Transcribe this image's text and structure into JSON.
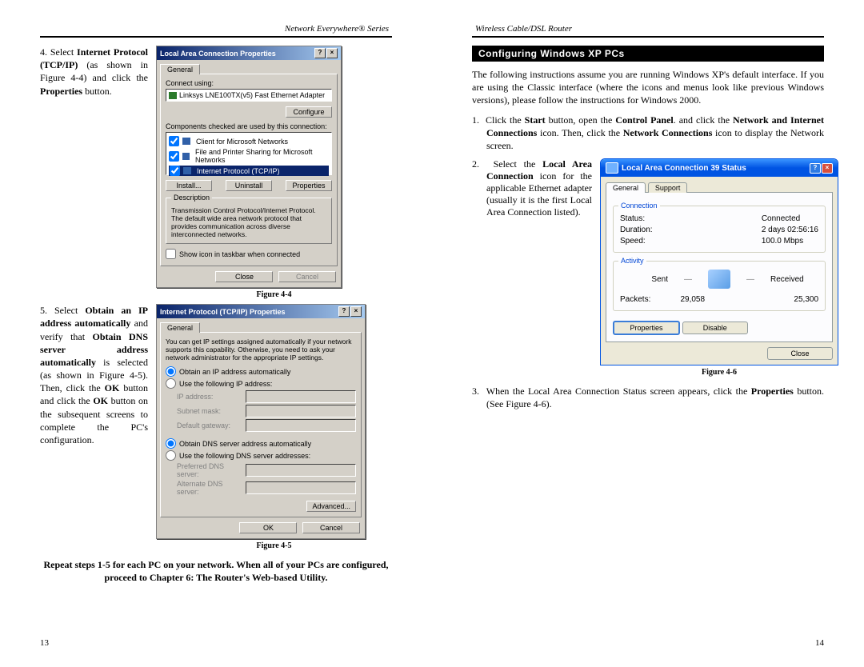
{
  "left": {
    "header": "Network Everywhere® Series",
    "page_no": "13",
    "step4": {
      "num": "4.",
      "text_pre": "Select ",
      "b1": "Internet Protocol (TCP/IP)",
      "text_mid": " (as shown in Figure 4-4) and click the ",
      "b2": "Properties",
      "text_post": " button."
    },
    "step5": {
      "num": "5.",
      "p1a": "Select ",
      "p1b": "Obtain an IP address automatically",
      "p1c": " and verify that ",
      "p1d": "Obtain DNS server address automatically",
      "p1e": " is selected (as shown in Figure 4-5). Then, click the ",
      "p1f": "OK",
      "p1g": " button and click the ",
      "p1h": "OK",
      "p1i": " button on the subsequent screens to complete the PC's configuration."
    },
    "footer_note": "Repeat steps 1-5 for each PC on your network.  When all of your PCs are configured, proceed to Chapter 6: The Router's Web-based Utility.",
    "fig44": {
      "caption": "Figure 4-4",
      "title": "Local Area Connection Properties",
      "tab_general": "General",
      "connect_using_lbl": "Connect using:",
      "adapter": "Linksys LNE100TX(v5) Fast Ethernet Adapter",
      "configure": "Configure",
      "components_lbl": "Components checked are used by this connection:",
      "comp1": "Client for Microsoft Networks",
      "comp2": "File and Printer Sharing for Microsoft Networks",
      "comp3": "Internet Protocol (TCP/IP)",
      "install": "Install...",
      "uninstall": "Uninstall",
      "properties": "Properties",
      "desc_lbl": "Description",
      "desc": "Transmission Control Protocol/Internet Protocol. The default wide area network protocol that provides communication across diverse interconnected networks.",
      "show_icon": "Show icon in taskbar when connected",
      "close": "Close",
      "cancel": "Cancel"
    },
    "fig45": {
      "caption": "Figure 4-5",
      "title": "Internet Protocol (TCP/IP) Properties",
      "tab_general": "General",
      "intro": "You can get IP settings assigned automatically if your network supports this capability. Otherwise, you need to ask your network administrator for the appropriate IP settings.",
      "r1": "Obtain an IP address automatically",
      "r2": "Use the following IP address:",
      "ip_lbl": "IP address:",
      "mask_lbl": "Subnet mask:",
      "gw_lbl": "Default gateway:",
      "r3": "Obtain DNS server address automatically",
      "r4": "Use the following DNS server addresses:",
      "pdns": "Preferred DNS server:",
      "adns": "Alternate DNS server:",
      "advanced": "Advanced...",
      "ok": "OK",
      "cancel": "Cancel"
    }
  },
  "right": {
    "header": "Wireless Cable/DSL Router",
    "page_no": "14",
    "section_title": "Configuring Windows XP PCs",
    "intro": "The following instructions assume you are running Windows XP's default interface. If you are using the Classic interface (where the icons and menus look like previous Windows versions), please follow the instructions for Windows 2000.",
    "step1": {
      "num": "1.",
      "a": "Click the ",
      "b": "Start",
      "c": " button, open the ",
      "d": "Control Panel",
      "e": ". and click the ",
      "f": "Network and Internet Connections",
      "g": " icon. Then, click the ",
      "h": "Network Connections",
      "i": " icon to display the Network screen."
    },
    "step2": {
      "num": "2.",
      "a": "Select the ",
      "b": "Local Area Connection",
      "c": " icon for the applicable Ethernet adapter (usually it is the first Local Area Connection listed)."
    },
    "step3": {
      "num": "3.",
      "a": "When the Local Area Connection Status screen appears, click the ",
      "b": "Properties",
      "c": " button. (See Figure 4-6)."
    },
    "fig46": {
      "caption": "Figure 4-6",
      "title": "Local Area Connection 39 Status",
      "tab_general": "General",
      "tab_support": "Support",
      "grp_conn": "Connection",
      "status_lbl": "Status:",
      "status_val": "Connected",
      "dur_lbl": "Duration:",
      "dur_val": "2 days 02:56:16",
      "speed_lbl": "Speed:",
      "speed_val": "100.0 Mbps",
      "grp_act": "Activity",
      "sent_lbl": "Sent",
      "recv_lbl": "Received",
      "pkts_lbl": "Packets:",
      "sent_val": "29,058",
      "recv_val": "25,300",
      "properties": "Properties",
      "disable": "Disable",
      "close": "Close"
    }
  }
}
